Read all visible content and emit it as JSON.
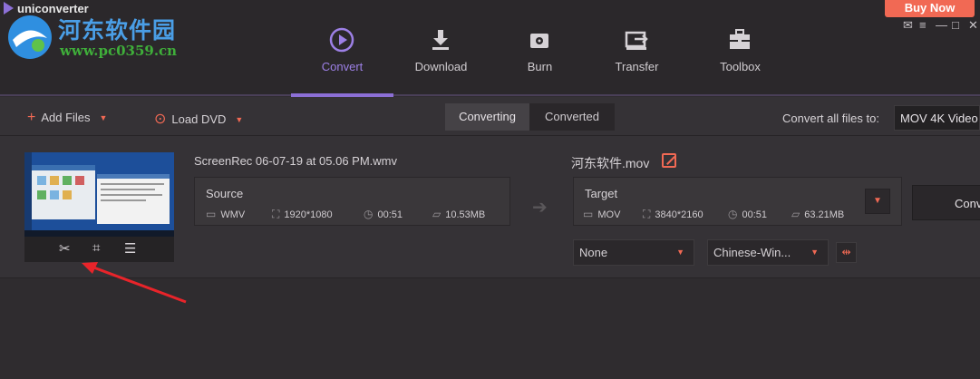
{
  "app": {
    "brand": "uniconverter",
    "buy_now": "Buy Now"
  },
  "watermark": {
    "title": "河东软件园",
    "url": "www.pc0359.cn"
  },
  "window_controls": [
    "✉",
    "≡",
    "—",
    "□",
    "✕"
  ],
  "nav": [
    {
      "label": "Convert",
      "icon": "convert-icon",
      "active": true
    },
    {
      "label": "Download",
      "icon": "download-icon",
      "active": false
    },
    {
      "label": "Burn",
      "icon": "burn-icon",
      "active": false
    },
    {
      "label": "Transfer",
      "icon": "transfer-icon",
      "active": false
    },
    {
      "label": "Toolbox",
      "icon": "toolbox-icon",
      "active": false
    }
  ],
  "toolbar": {
    "add_files": "Add Files",
    "load_dvd": "Load DVD",
    "tabs": [
      "Converting",
      "Converted"
    ],
    "active_tab": "Converting",
    "convert_all_label": "Convert all files to:",
    "convert_all_value": "MOV 4K Video"
  },
  "item": {
    "file_name": "ScreenRec 06-07-19 at 05.06 PM.wmv",
    "source": {
      "title": "Source",
      "format": "WMV",
      "resolution": "1920*1080",
      "duration": "00:51",
      "size": "10.53MB"
    },
    "target_name": "河东软件.mov",
    "target": {
      "title": "Target",
      "format": "MOV",
      "resolution": "3840*2160",
      "duration": "00:51",
      "size": "63.21MB"
    },
    "convert_button": "Conv",
    "subtitle_select": "None",
    "audio_select": "Chinese-Win..."
  },
  "colors": {
    "accent": "#8c6fd6",
    "orange": "#f16954",
    "background": "#2f2c2f"
  }
}
